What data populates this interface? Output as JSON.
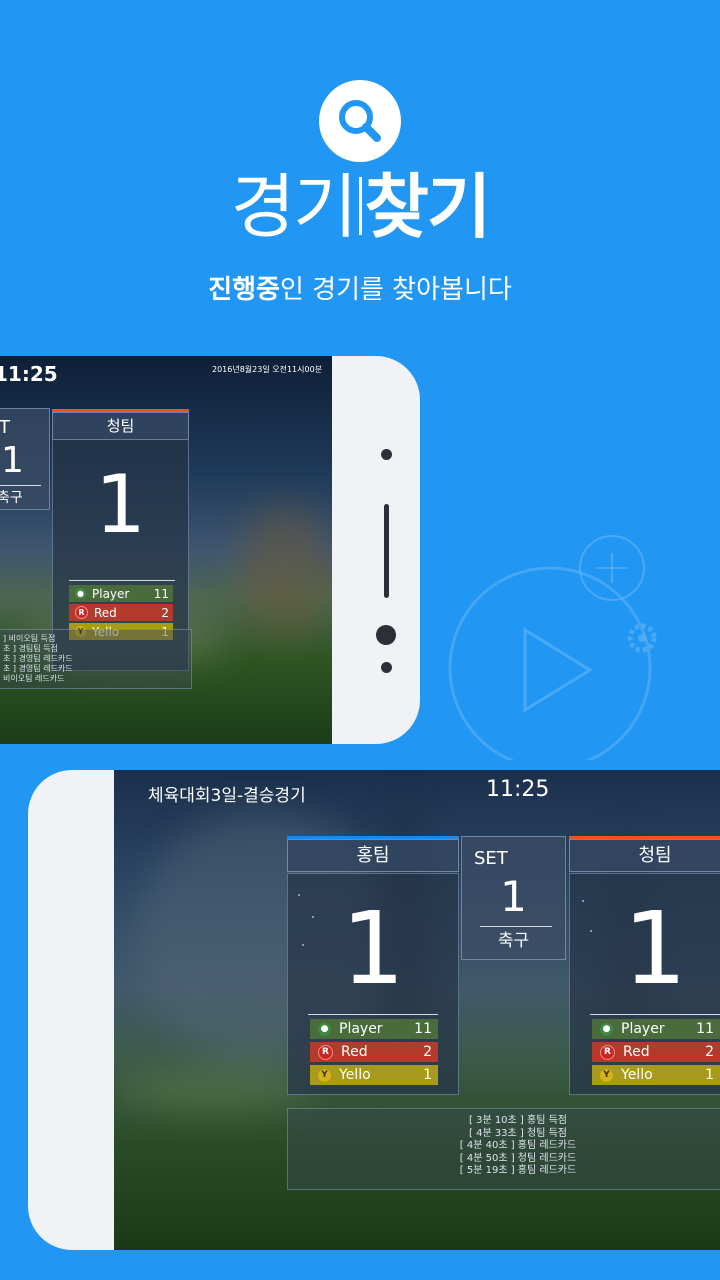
{
  "header": {
    "title_light": "경기",
    "title_bold": "찾기",
    "subtitle_bold": "진행중",
    "subtitle_rest": "인 경기를 찾아봅니다"
  },
  "icons": [
    "search-icon",
    "plus-circle-icon",
    "play-icon",
    "gear-icon"
  ],
  "colors": {
    "background": "#2196f3",
    "red_team_bar": "#f4511e",
    "blue_team_bar": "#1e88e5"
  },
  "screen1": {
    "clock": "11:25",
    "datetime": "2016년8월23일 오전11시00분",
    "set_label": "T",
    "set_number": "1",
    "sport": "축구",
    "team_name": "청팀",
    "score": "1",
    "stats": [
      {
        "label": "Player",
        "value": "11",
        "icon": "R"
      },
      {
        "label": "Red",
        "value": "2",
        "icon": "R"
      },
      {
        "label": "Yello",
        "value": "1",
        "icon": "Y"
      }
    ],
    "log": [
      "] 비이오팀 득점",
      "초 ] 경팀팀 득점",
      "초 ] 경영팀 레드카드",
      "초 ] 경영팀 레드카드",
      "비이오팀 레드카드"
    ]
  },
  "screen2": {
    "event_title": "체육대회3일-결승경기",
    "clock": "11:25",
    "team_left": {
      "name": "홍팀",
      "score": "1"
    },
    "set": {
      "label": "SET",
      "number": "1",
      "sport": "축구"
    },
    "team_right": {
      "name": "청팀",
      "score": "1"
    },
    "stats_left": [
      {
        "label": "Player",
        "value": "11",
        "icon": "R"
      },
      {
        "label": "Red",
        "value": "2",
        "icon": "R"
      },
      {
        "label": "Yello",
        "value": "1",
        "icon": "Y"
      }
    ],
    "stats_right": [
      {
        "label": "Player",
        "value": "11",
        "icon": "R"
      },
      {
        "label": "Red",
        "value": "2",
        "icon": "R"
      },
      {
        "label": "Yello",
        "value": "1",
        "icon": "Y"
      }
    ],
    "log": [
      "[ 3분 10초 ] 홍팀 득점",
      "[ 4분 33초 ] 청팀 득점",
      "[ 4분 40초 ] 홍팀 레드카드",
      "[ 4분 50초 ] 청팀 레드카드",
      "[ 5분 19초 ] 홍팀 레드카드"
    ]
  }
}
